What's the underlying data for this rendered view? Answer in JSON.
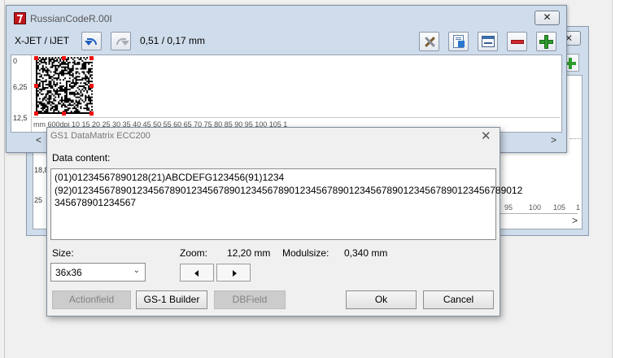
{
  "main_window": {
    "title": "RussianCodeR.00I",
    "close_glyph": "✕",
    "printer_label": "X-JET / iJET",
    "size_readout": "0,51 / 0,17 mm",
    "toolbar_icons": [
      "undo-icon",
      "redo-icon",
      "tools-icon",
      "document-icon",
      "window-icon",
      "minus-icon",
      "plus-icon"
    ]
  },
  "ruler": {
    "vertical": [
      "0",
      "6,25",
      "12,5",
      "18,8",
      "25"
    ],
    "horizontal": "mm    600dpi 10   15   20   25   30   35   40   45   50   55   60   65   70   75   80   85   90   95   100   105   1"
  },
  "back_window": {
    "close_glyph": "✕",
    "ruler_fragment": [
      "95",
      "100",
      "105",
      "1"
    ]
  },
  "dialog": {
    "title": "GS1 DataMatrix ECC200",
    "close_glyph": "✕",
    "data_content_label": "Data content:",
    "data_lines": [
      "(01)01234567890128(21)ABCDEFG123456(91)1234",
      "(92)01234567890123456789012345678901234567890123456789012345678901234567890123456789012",
      "345678901234567"
    ],
    "size_label": "Size:",
    "size_value": "36x36",
    "zoom_label": "Zoom:",
    "zoom_value": "12,20 mm",
    "modulsize_label": "Modulsize:",
    "modulsize_value": "0,340 mm",
    "buttons": {
      "actionfield": "Actionfield",
      "gs1_builder": "GS-1 Builder",
      "dbfield": "DBField",
      "ok": "Ok",
      "cancel": "Cancel"
    }
  }
}
